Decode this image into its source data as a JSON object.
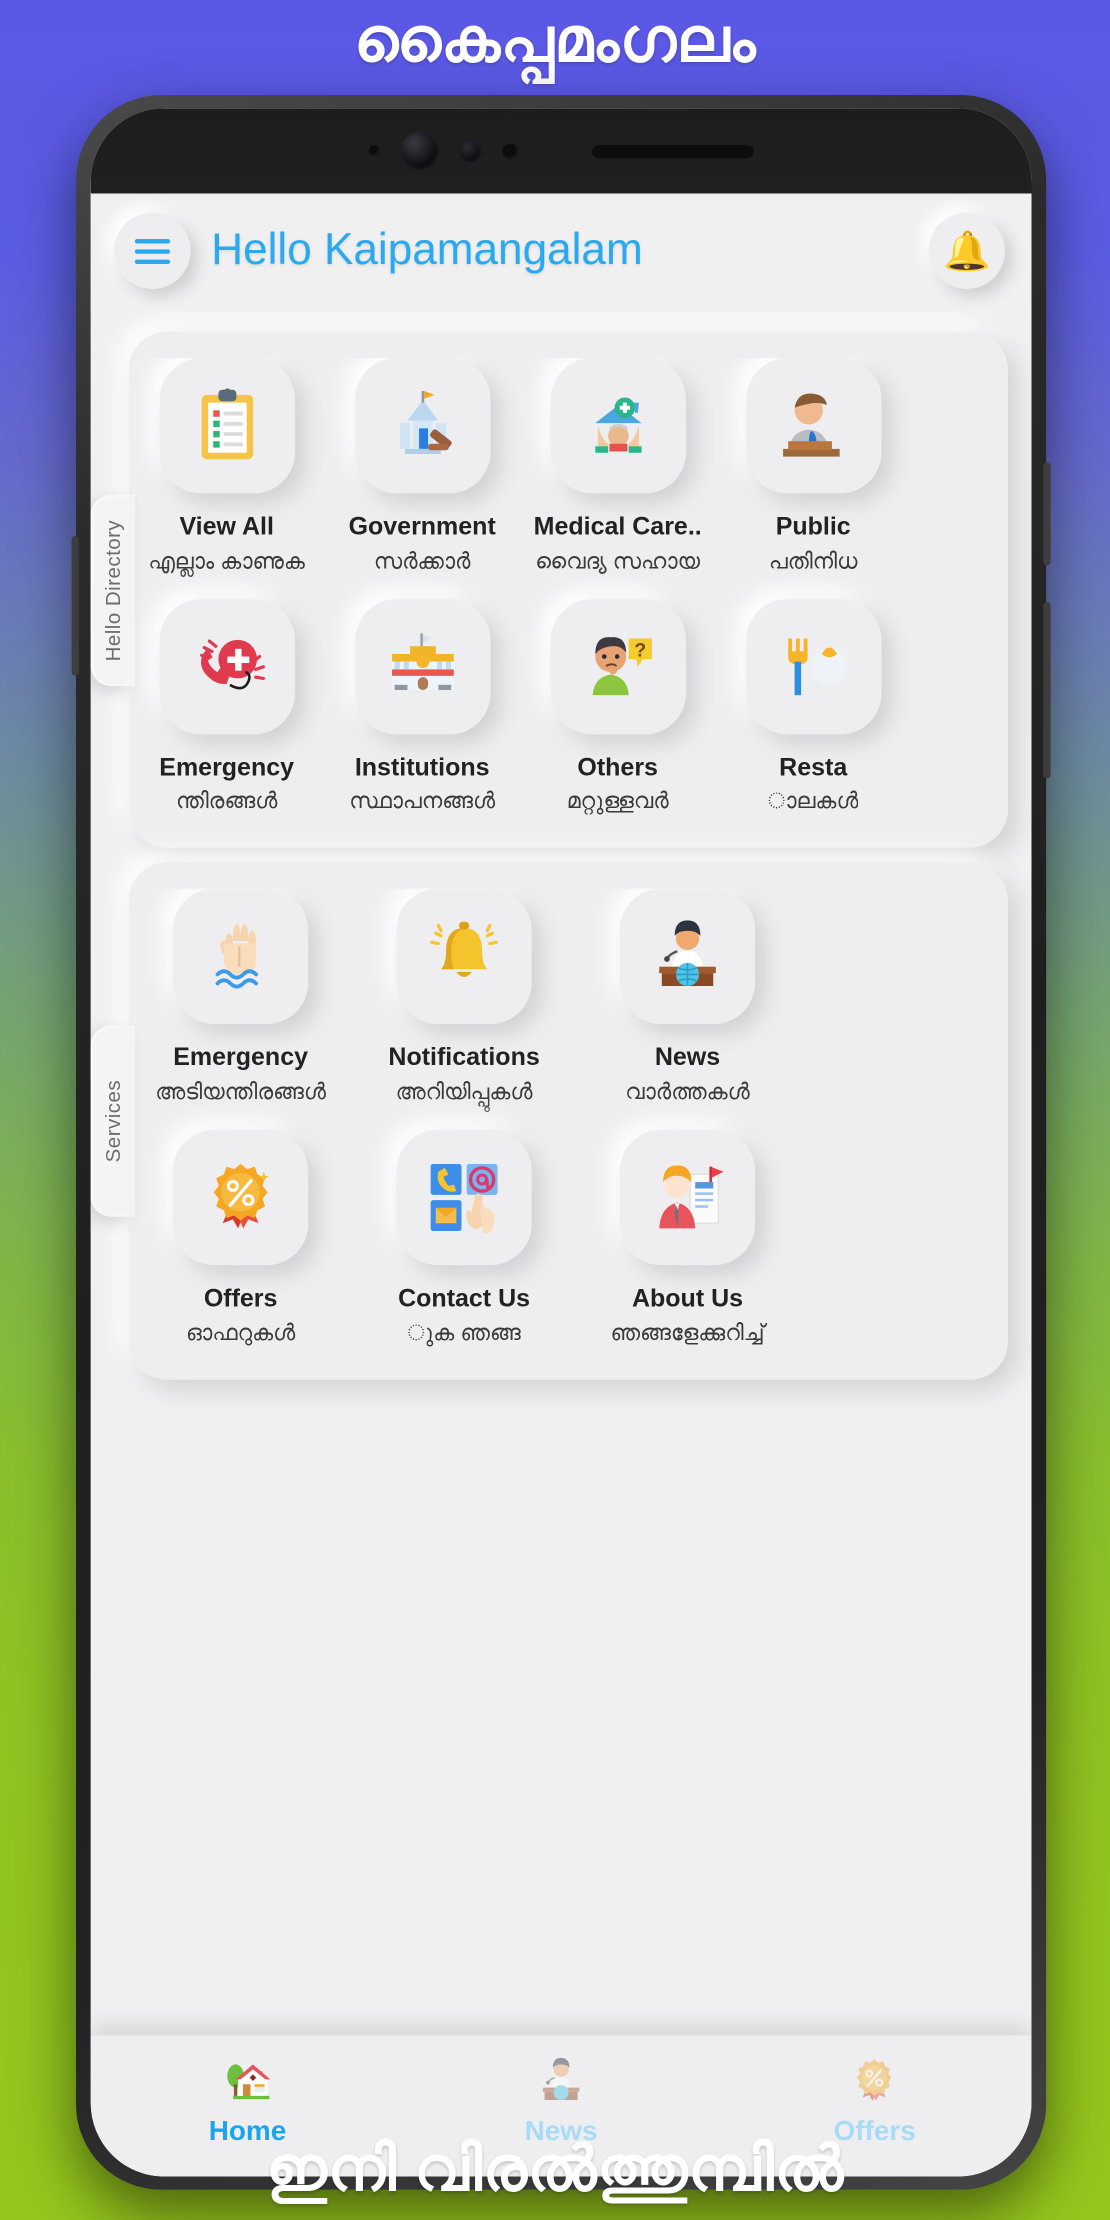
{
  "promo": {
    "top_text": "കൈപ്പമംഗലം",
    "bottom_text": "ഇനി വിരൽത്തുമ്പിൽ"
  },
  "colors": {
    "accent_blue": "#29a9ef",
    "nav_active": "#18a6f0",
    "nav_inactive": "#a8dcf6",
    "surface": "#eeeef0",
    "bg_top": "#5b58e6",
    "bg_bottom": "#95c61d"
  },
  "appbar": {
    "menu_icon": "hamburger-menu-icon",
    "title": "Hello Kaipamangalam",
    "notification_icon": "bell-icon"
  },
  "sections": [
    {
      "tab_label": "Hello Directory",
      "rows": [
        [
          {
            "icon": "clipboard-icon",
            "en": "View All",
            "ml": "എല്ലാം കാണുക"
          },
          {
            "icon": "government-icon",
            "en": "Government",
            "ml": "സർക്കാർ"
          },
          {
            "icon": "medical-care-icon",
            "en": "Medical Care..",
            "ml": "വൈദ്യ സഹായ"
          },
          {
            "icon": "public-rep-icon",
            "en": "Public",
            "ml": "പതിനിധ"
          }
        ],
        [
          {
            "icon": "emergency-call-icon",
            "en": "Emergency",
            "ml": "ന്തിരങ്ങൾ"
          },
          {
            "icon": "institutions-icon",
            "en": "Institutions",
            "ml": "സ്ഥാപനങ്ങൾ"
          },
          {
            "icon": "others-icon",
            "en": "Others",
            "ml": "മറ്റുള്ളവർ"
          },
          {
            "icon": "restaurant-icon",
            "en": "Resta",
            "ml": "ാലകൾ"
          }
        ]
      ]
    },
    {
      "tab_label": "Services",
      "rows": [
        [
          {
            "icon": "raised-hand-sos-icon",
            "en": "Emergency",
            "ml": "അടിയന്തിരങ്ങൾ"
          },
          {
            "icon": "bell-ring-icon",
            "en": "Notifications",
            "ml": "അറിയിപ്പുകൾ"
          },
          {
            "icon": "news-anchor-icon",
            "en": "News",
            "ml": "വാർത്തകൾ"
          }
        ],
        [
          {
            "icon": "offer-badge-icon",
            "en": "Offers",
            "ml": "ഓഫറുകൾ"
          },
          {
            "icon": "contact-us-icon",
            "en": "Contact Us",
            "ml": "ുക        ഞങ്ങ"
          },
          {
            "icon": "about-us-icon",
            "en": "About Us",
            "ml": "ഞങ്ങളേക്കുറിച്ച്"
          }
        ]
      ]
    }
  ],
  "bottom_nav": [
    {
      "icon": "home-icon",
      "label": "Home",
      "state": "active"
    },
    {
      "icon": "news-icon",
      "label": "News",
      "state": "inactive"
    },
    {
      "icon": "offers-icon",
      "label": "Offers",
      "state": "inactive"
    }
  ]
}
